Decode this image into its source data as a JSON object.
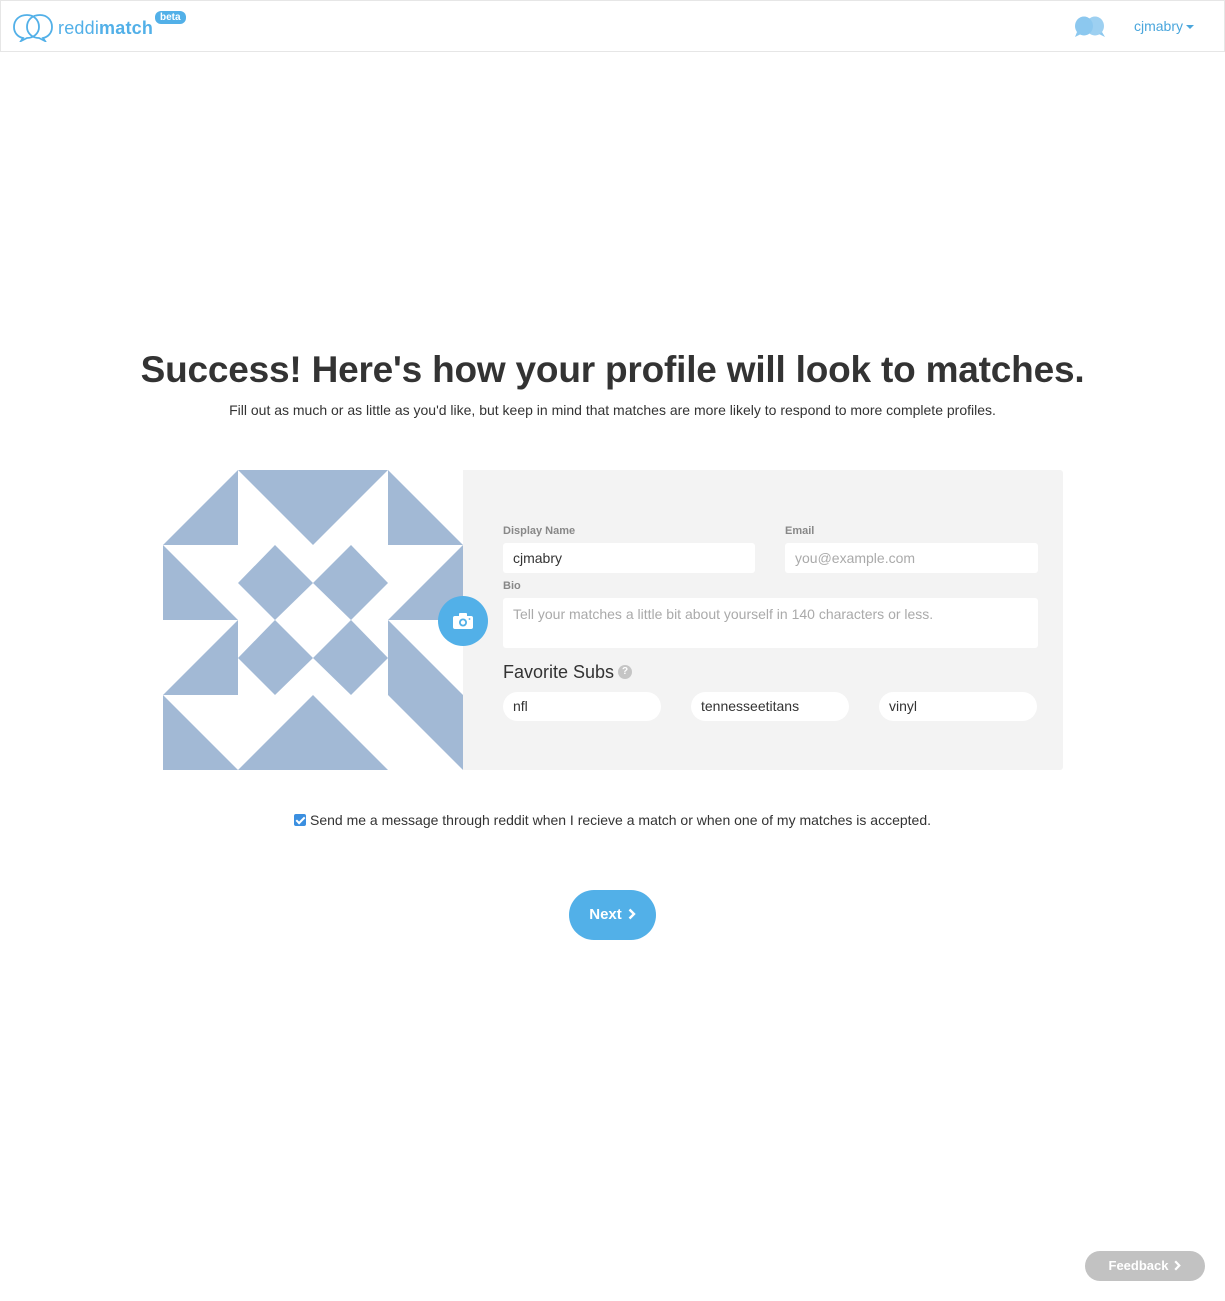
{
  "nav": {
    "logo_light": "reddi",
    "logo_bold": "match",
    "badge": "beta",
    "username": "cjmabry"
  },
  "page": {
    "title": "Success! Here's how your profile will look to matches.",
    "subtitle": "Fill out as much or as little as you'd like, but keep in mind that matches are more likely to respond to more complete profiles."
  },
  "profile": {
    "display_name_label": "Display Name",
    "display_name_value": "cjmabry",
    "email_label": "Email",
    "email_placeholder": "you@example.com",
    "email_value": "",
    "bio_label": "Bio",
    "bio_placeholder": "Tell your matches a little bit about yourself in 140 characters or less.",
    "favorite_subs_label": "Favorite Subs",
    "help_glyph": "?",
    "subs": [
      "nfl",
      "tennesseetitans",
      "vinyl"
    ]
  },
  "notify_label": "Send me a message through reddit when I recieve a match or when one of my matches is accepted.",
  "notify_checked": true,
  "next_label": "Next",
  "feedback_label": "Feedback",
  "colors": {
    "accent": "#52b0e8",
    "avatar_bg": "#a2b9d5",
    "card_bg": "#f3f3f3"
  },
  "icons": {
    "logo": "speech-bubbles-icon",
    "nav": "chat-bubbles-icon",
    "camera": "camera-icon",
    "next": "chevron-right-icon"
  }
}
